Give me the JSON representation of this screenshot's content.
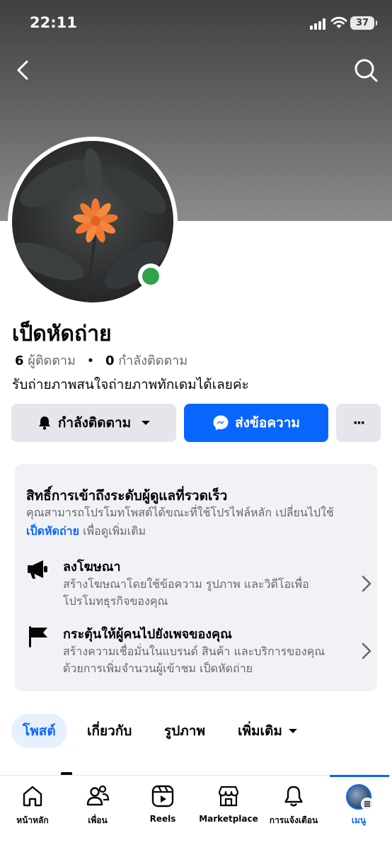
{
  "status_bar": {
    "time": "22:11",
    "battery": "37"
  },
  "header": {
    "back_icon": "chevron-left-icon",
    "search_icon": "search-icon"
  },
  "profile": {
    "name": "เป็ดหัดถ่าย",
    "followers_count": "6",
    "followers_label": "ผู้ติดตาม",
    "following_count": "0",
    "following_label": "กำลังติดตาม",
    "separator": "•",
    "bio": "รับถ่ายภาพสนใจถ่ายภาพทักเดมได้เลยค่ะ",
    "online": true
  },
  "actions": {
    "following_label": "กำลังติดตาม",
    "message_label": "ส่งข้อความ",
    "more_label": "···"
  },
  "access_card": {
    "title": "สิทธิ์การเข้าถึงระดับผู้ดูแลที่รวดเร็ว",
    "desc_prefix": "คุณสามารถโปรโมทโพสต์ได้ขณะที่ใช้โปรไฟล์หลัก เปลี่ยนไปใช้",
    "desc_link": "เป็ดหัดถ่าย",
    "desc_suffix": " เพื่อดูเพิ่มเติม",
    "items": [
      {
        "icon": "megaphone-icon",
        "title": "ลงโฆษณา",
        "desc_line1": "สร้างโฆษณาโดยใช้ข้อความ รูปภาพ และวิดีโอเพื่อ",
        "desc_line2": "โปรโมทธุรกิจของคุณ"
      },
      {
        "icon": "flag-icon",
        "title": "กระตุ้นให้ผู้คนไปยังเพจของคุณ",
        "desc_line1": "สร้างความเชื่อมั่นในแบรนด์ สินค้า และบริการของคุณ",
        "desc_line2": "ด้วยการเพิ่มจำนวนผู้เข้าชม เป็ดหัดถ่าย"
      }
    ]
  },
  "tabs": [
    {
      "label": "โพสต์",
      "active": true
    },
    {
      "label": "เกี่ยวกับ",
      "active": false
    },
    {
      "label": "รูปภาพ",
      "active": false
    },
    {
      "label": "เพิ่มเติม",
      "active": false
    }
  ],
  "bottom_nav": [
    {
      "icon": "home-icon",
      "label": "หน้าหลัก"
    },
    {
      "icon": "friends-icon",
      "label": "เพื่อน"
    },
    {
      "icon": "reels-icon",
      "label": "Reels"
    },
    {
      "icon": "marketplace-icon",
      "label": "Marketplace"
    },
    {
      "icon": "bell-icon",
      "label": "การแจ้งเตือน"
    },
    {
      "icon": "menu-avatar-icon",
      "label": "เมนู",
      "active": true
    }
  ],
  "colors": {
    "accent": "#0866ff",
    "online": "#31a24c",
    "secondary_text": "#65676b",
    "card_bg": "#f0f2f5"
  }
}
